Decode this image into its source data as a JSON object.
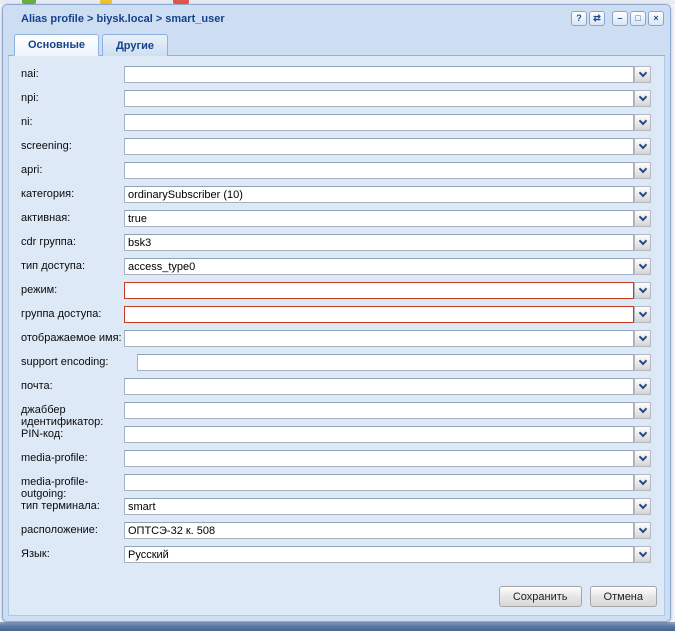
{
  "window": {
    "title": "Alias profile > biysk.local > smart_user",
    "tools": [
      {
        "name": "help",
        "glyph": "?"
      },
      {
        "name": "refresh",
        "glyph": "⇄"
      },
      {
        "name": "minimize",
        "glyph": "–"
      },
      {
        "name": "maximize",
        "glyph": "□"
      },
      {
        "name": "close",
        "glyph": "×"
      }
    ]
  },
  "tabs": [
    {
      "label": "Основные",
      "active": true
    },
    {
      "label": "Другие",
      "active": false
    }
  ],
  "form": {
    "fields": [
      {
        "label": "nai:",
        "value": "",
        "invalid": false,
        "indent": 0,
        "gap_before": 0
      },
      {
        "label": "npi:",
        "value": "",
        "invalid": false,
        "indent": 0,
        "gap_before": 0
      },
      {
        "label": "ni:",
        "value": "",
        "invalid": false,
        "indent": 0,
        "gap_before": 0
      },
      {
        "label": "screening:",
        "value": "",
        "invalid": false,
        "indent": 0,
        "gap_before": 0
      },
      {
        "label": "apri:",
        "value": "",
        "invalid": false,
        "indent": 0,
        "gap_before": 0
      },
      {
        "label": "категория:",
        "value": "ordinarySubscriber (10)",
        "invalid": false,
        "indent": 0,
        "gap_before": 0
      },
      {
        "label": "активная:",
        "value": "true",
        "invalid": false,
        "indent": 0,
        "gap_before": 0
      },
      {
        "label": "cdr группа:",
        "value": "bsk3",
        "invalid": false,
        "indent": 0,
        "gap_before": 0
      },
      {
        "label": "тип доступа:",
        "value": "access_type0",
        "invalid": false,
        "indent": 0,
        "gap_before": 0
      },
      {
        "label": "режим:",
        "value": "",
        "invalid": true,
        "indent": 0,
        "gap_before": 0
      },
      {
        "label": "группа доступа:",
        "value": "",
        "invalid": true,
        "indent": 0,
        "gap_before": 0
      },
      {
        "label": "отображаемое имя:",
        "value": "",
        "invalid": false,
        "indent": 0,
        "gap_before": 5
      },
      {
        "label": "support encoding:",
        "value": "",
        "invalid": false,
        "indent": 13,
        "gap_before": 0
      },
      {
        "label": "почта:",
        "value": "",
        "invalid": false,
        "indent": 0,
        "gap_before": 0
      },
      {
        "label": "джаббер идентификатор:",
        "value": "",
        "invalid": false,
        "indent": 0,
        "gap_before": 0
      },
      {
        "label": "PIN-код:",
        "value": "",
        "invalid": false,
        "indent": 0,
        "gap_before": 0
      },
      {
        "label": "media-profile:",
        "value": "",
        "invalid": false,
        "indent": 0,
        "gap_before": 0
      },
      {
        "label": "media-profile-outgoing:",
        "value": "",
        "invalid": false,
        "indent": 0,
        "gap_before": 0
      },
      {
        "label": "тип терминала:",
        "value": "smart",
        "invalid": false,
        "indent": 0,
        "gap_before": 0
      },
      {
        "label": "расположение:",
        "value": "ОПТСЭ-32 к. 508",
        "invalid": false,
        "indent": 0,
        "gap_before": 0
      },
      {
        "label": "Язык:",
        "value": "Русский",
        "invalid": false,
        "indent": 0,
        "gap_before": 0
      }
    ]
  },
  "footer": {
    "buttons": [
      {
        "label": "Сохранить"
      },
      {
        "label": "Отмена"
      }
    ]
  },
  "colors": {
    "title_text": "#15428b",
    "window_frame": "#cddef2",
    "window_border": "#8ea9cf",
    "body_background": "#dee9f8",
    "invalid_border": "#c43c1d",
    "trigger_arrow": "#274a80",
    "bottom_band": "#47658e",
    "partial_icons": [
      "#6cae3e",
      "#f2c12f",
      "#e2554a"
    ]
  }
}
